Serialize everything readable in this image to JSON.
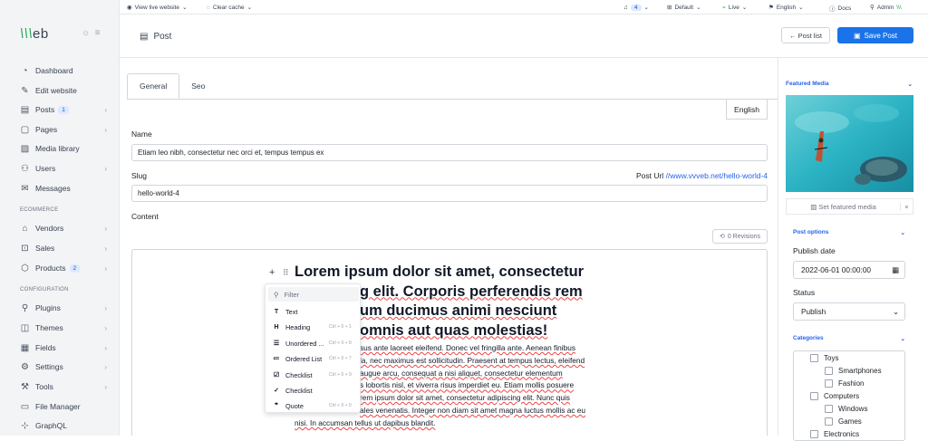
{
  "logo": "Vvveb",
  "sidebar": {
    "items": [
      {
        "label": "Dashboard",
        "icon": "dashboard-icon"
      },
      {
        "label": "Edit website",
        "icon": "paint-brush-icon"
      },
      {
        "label": "Posts",
        "icon": "document-icon",
        "badge": "1"
      },
      {
        "label": "Pages",
        "icon": "page-icon"
      },
      {
        "label": "Media library",
        "icon": "image-icon"
      },
      {
        "label": "Users",
        "icon": "users-icon"
      },
      {
        "label": "Messages",
        "icon": "envelope-icon"
      },
      {
        "label": "Vendors",
        "icon": "store-icon"
      },
      {
        "label": "Sales",
        "icon": "cart-icon"
      },
      {
        "label": "Products",
        "icon": "box-icon",
        "badge": "2"
      },
      {
        "label": "Plugins",
        "icon": "plug-icon"
      },
      {
        "label": "Themes",
        "icon": "palette-icon"
      },
      {
        "label": "Fields",
        "icon": "fields-icon"
      },
      {
        "label": "Settings",
        "icon": "gear-icon"
      },
      {
        "label": "Tools",
        "icon": "wrench-icon"
      },
      {
        "label": "File Manager",
        "icon": "folder-icon"
      },
      {
        "label": "GraphQL",
        "icon": "graph-icon"
      }
    ],
    "sections": [
      "ECOMMERCE",
      "CONFIGURATION"
    ]
  },
  "topbar": {
    "view_live": "View live website",
    "clear_cache": "Clear cache",
    "notifications": "4",
    "site": "Default",
    "state": "Live",
    "language": "English",
    "docs": "Docs",
    "user": "Admin"
  },
  "header": {
    "title": "Post",
    "post_list": "Post list",
    "save": "Save Post"
  },
  "tabs": [
    "General",
    "Seo"
  ],
  "lang_tab": "English",
  "form": {
    "name_label": "Name",
    "name_value": "Etiam leo nibh, consectetur nec orci et, tempus tempus ex",
    "slug_label": "Slug",
    "slug_value": "hello-world-4",
    "post_url_label": "Post Url",
    "post_url": "//www.vvveb.net/hello-world-4",
    "content_label": "Content",
    "revisions": "0 Revisions"
  },
  "editor": {
    "heading_lines": [
      "Lorem ipsum dolor sit amet, consectetur",
      "g elit. Corporis perferendis rem",
      "um ducimus animi nesciunt",
      "omnis aut quas molestias!"
    ],
    "para_lines": [
      "sus ante laoreet eleifend. Donec vel fringilla ante. Aenean finibus",
      "la, nec maximus est sollicitudin. Praesent at tempus lectus, eleifend",
      "augue arcu, consequat a nisi aliquet, consectetur elementum",
      "s lobortis nisl, et viverra risus imperdiet eu. Etiam mollis posuere",
      "rem ipsum dolor sit amet, consectetur adipiscing elit. Nunc quis",
      "ales venenatis. Integer non diam sit amet magna luctus mollis ac eu",
      "nisi. In accumsan tellus ut dapibus blandit."
    ],
    "menu": {
      "filter": "Filter",
      "items": [
        {
          "label": "Text",
          "icon": "T",
          "shortcut": ""
        },
        {
          "label": "Heading",
          "icon": "H",
          "shortcut": "Ctrl + 0 + 1"
        },
        {
          "label": "Unordered ...",
          "icon": "☰",
          "shortcut": "Ctrl + 0 + 8"
        },
        {
          "label": "Ordered List",
          "icon": "≔",
          "shortcut": "Ctrl + 0 + 7"
        },
        {
          "label": "Checklist",
          "icon": "☑",
          "shortcut": "Ctrl + 0 + 9"
        },
        {
          "label": "Checklist",
          "icon": "✓",
          "shortcut": ""
        },
        {
          "label": "Quote",
          "icon": "❞",
          "shortcut": "Ctrl + 0 + 0"
        }
      ]
    }
  },
  "right": {
    "featured_media": "Featured Media",
    "set_featured": "Set featured media",
    "post_options": "Post options",
    "publish_date_label": "Publish date",
    "publish_date": "2022-06-01 00:00:00",
    "status_label": "Status",
    "status": "Publish",
    "categories": "Categories",
    "cat_items": [
      {
        "label": "Toys",
        "level": 0
      },
      {
        "label": "Smartphones",
        "level": 1
      },
      {
        "label": "Fashion",
        "level": 1
      },
      {
        "label": "Computers",
        "level": 0
      },
      {
        "label": "Windows",
        "level": 1
      },
      {
        "label": "Games",
        "level": 1
      },
      {
        "label": "Electronics",
        "level": 0
      }
    ]
  }
}
